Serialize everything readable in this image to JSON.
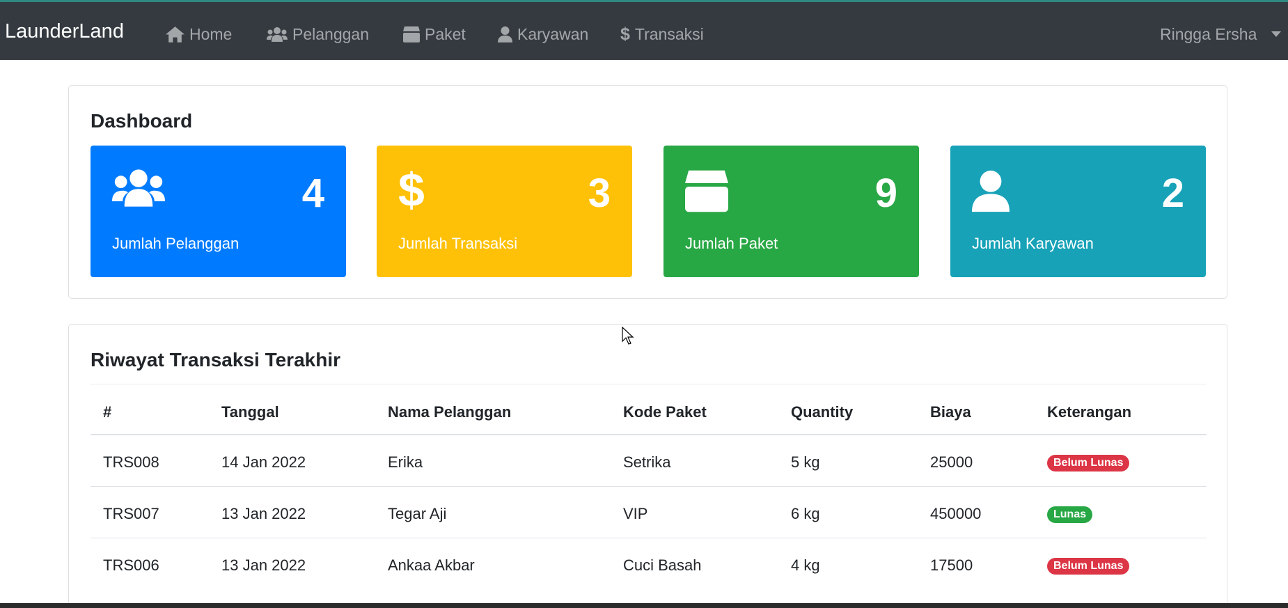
{
  "app": {
    "brand": "LaunderLand"
  },
  "nav": {
    "items": [
      {
        "label": "Home",
        "icon": "home-icon"
      },
      {
        "label": "Pelanggan",
        "icon": "users-icon"
      },
      {
        "label": "Paket",
        "icon": "box-icon"
      },
      {
        "label": "Karyawan",
        "icon": "user-icon"
      },
      {
        "label": "Transaksi",
        "icon": "dollar-icon"
      }
    ],
    "user_name": "Ringga Ersha"
  },
  "dashboard": {
    "title": "Dashboard",
    "stats": [
      {
        "label": "Jumlah Pelanggan",
        "value": "4",
        "icon": "users-icon",
        "color": "#007bff"
      },
      {
        "label": "Jumlah Transaksi",
        "value": "3",
        "icon": "dollar-icon",
        "color": "#ffc107"
      },
      {
        "label": "Jumlah Paket",
        "value": "9",
        "icon": "box-icon",
        "color": "#28a745"
      },
      {
        "label": "Jumlah Karyawan",
        "value": "2",
        "icon": "user-icon",
        "color": "#17a2b8"
      }
    ]
  },
  "transactions": {
    "title": "Riwayat Transaksi Terakhir",
    "columns": [
      "#",
      "Tanggal",
      "Nama Pelanggan",
      "Kode Paket",
      "Quantity",
      "Biaya",
      "Keterangan"
    ],
    "rows": [
      {
        "id": "TRS008",
        "date": "14 Jan 2022",
        "customer": "Erika",
        "package": "Setrika",
        "qty": "5 kg",
        "cost": "25000",
        "status": "Belum Lunas",
        "status_color": "#dc3545"
      },
      {
        "id": "TRS007",
        "date": "13 Jan 2022",
        "customer": "Tegar Aji",
        "package": "VIP",
        "qty": "6 kg",
        "cost": "450000",
        "status": "Lunas",
        "status_color": "#28a745"
      },
      {
        "id": "TRS006",
        "date": "13 Jan 2022",
        "customer": "Ankaa Akbar",
        "package": "Cuci Basah",
        "qty": "4 kg",
        "cost": "17500",
        "status": "Belum Lunas",
        "status_color": "#dc3545"
      }
    ]
  }
}
